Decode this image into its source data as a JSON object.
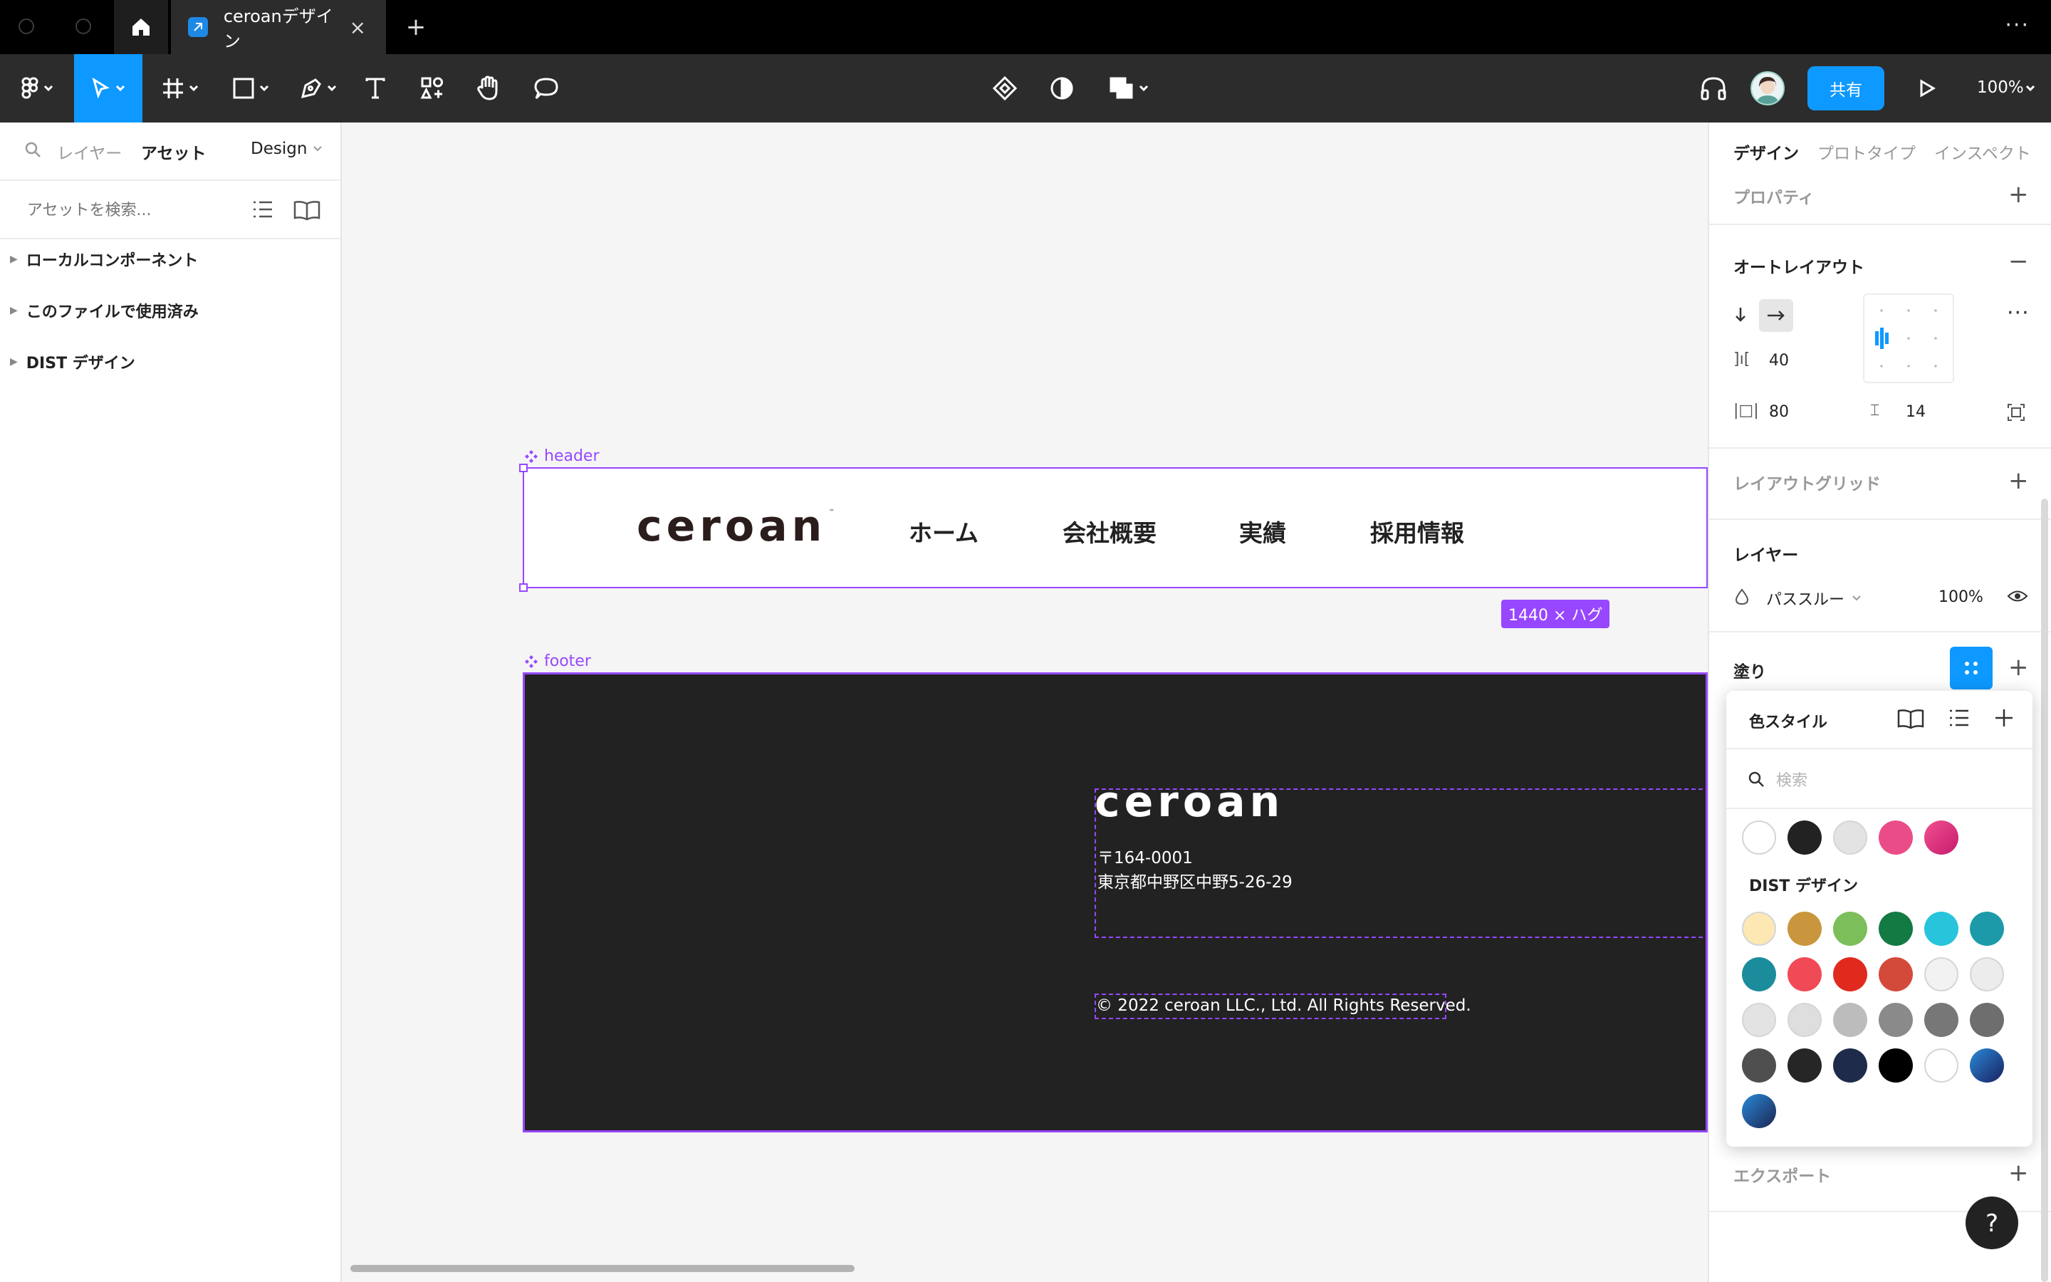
{
  "titlebar": {
    "file_tab_title": "ceroanデザイン",
    "close_glyph": "×",
    "new_tab_glyph": "+",
    "more_glyph": "···"
  },
  "toolbar": {
    "share_label": "共有",
    "zoom_label": "100%"
  },
  "left_panel": {
    "tabs": {
      "layers": "レイヤー",
      "assets": "アセット",
      "page": "Design"
    },
    "search_placeholder": "アセットを検索...",
    "libraries": [
      {
        "label": "ローカルコンポーネント"
      },
      {
        "label": "このファイルで使用済み"
      },
      {
        "label": "DIST デザイン"
      }
    ]
  },
  "canvas": {
    "header_frame": {
      "label": "header",
      "logo": "ceroan",
      "nav": [
        "ホーム",
        "会社概要",
        "実績",
        "採用情報"
      ],
      "size_badge": "1440 × ハグ"
    },
    "footer_frame": {
      "label": "footer",
      "logo": "ceroan",
      "postal": "〒164-0001",
      "address": "東京都中野区中野5-26-29",
      "copyright": "© 2022 ceroan LLC., Ltd. All Rights Reserved."
    }
  },
  "right_panel": {
    "tabs": {
      "design": "デザイン",
      "prototype": "プロトタイプ",
      "inspect": "インスペクト"
    },
    "properties_label": "プロパティ",
    "auto_layout": {
      "title": "オートレイアウト",
      "gap": "40",
      "padding_horizontal": "80",
      "padding_vertical": "14"
    },
    "layout_grid_label": "レイアウトグリッド",
    "layer": {
      "title": "レイヤー",
      "blend_mode": "パススルー",
      "opacity": "100%"
    },
    "fill_label": "塗り",
    "export_label": "エクスポート"
  },
  "color_styles_popup": {
    "title": "色スタイル",
    "search_placeholder": "検索",
    "local_swatches": [
      "#ffffff",
      "#222222",
      "#e3e3e3",
      "#ea4c89",
      "gradient-pink"
    ],
    "library_title": "DIST デザイン",
    "library_swatches": [
      "#fde8b4",
      "#c9963d",
      "#7cbf5a",
      "#137a43",
      "#27c4dc",
      "#1d9aaa",
      "#1b8c9c",
      "#ef4a55",
      "#e12a1e",
      "#d44a3a",
      "#f2f2f2",
      "#ececec",
      "#e3e3e3",
      "#dedede",
      "#bcbcbc",
      "#8a8a8a",
      "#777777",
      "#6e6e6e",
      "#4f4f4f",
      "#262626",
      "#1f2b4a",
      "#000000",
      "#ffffff",
      "gradient-navy",
      "gradient-navy2"
    ]
  },
  "help_glyph": "?"
}
